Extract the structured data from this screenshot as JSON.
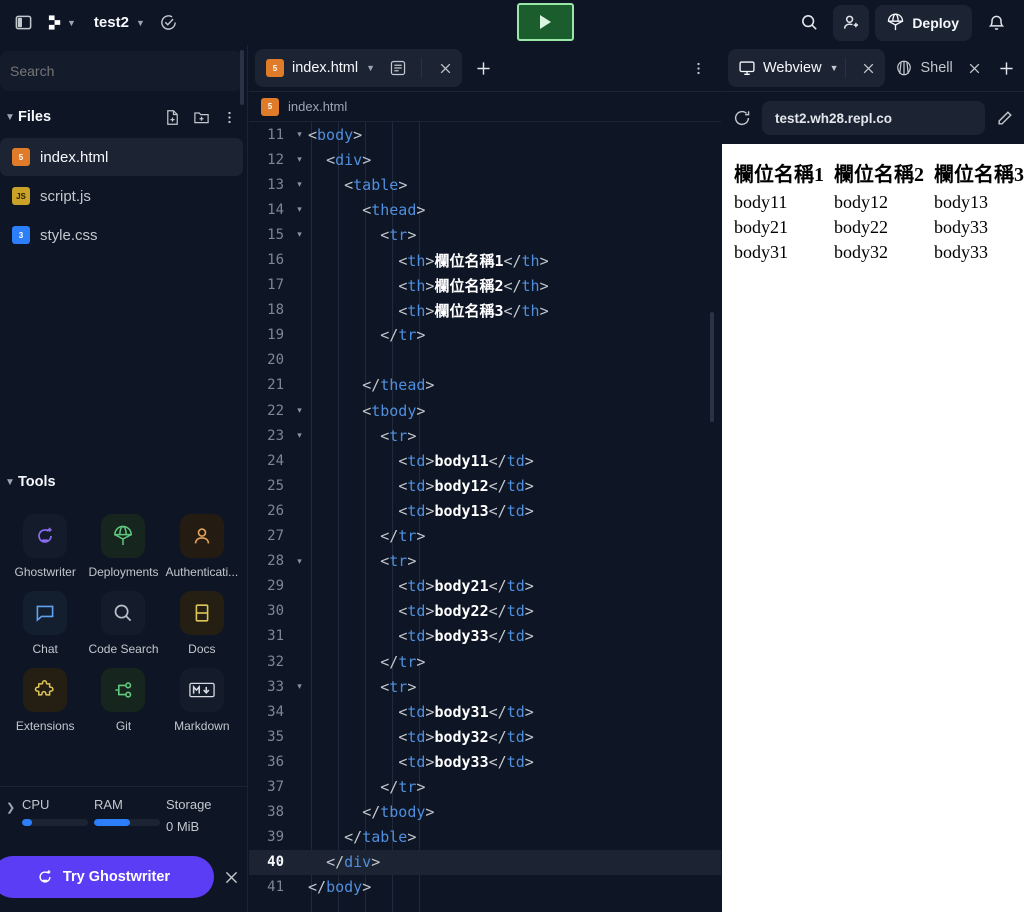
{
  "topbar": {
    "sidebar_toggle": "sidebar-toggle",
    "app_menu": "replit-logo",
    "project_name": "test2",
    "history_icon": "history-check-icon",
    "run_label": "run",
    "search_icon": "search-icon",
    "invite_icon": "invite-user-icon",
    "deploy_label": "Deploy",
    "notifications_icon": "bell-icon"
  },
  "sidebar": {
    "search": {
      "placeholder": "Search",
      "value": ""
    },
    "files_section": {
      "title": "Files",
      "new_file_icon": "new-file-icon",
      "new_folder_icon": "new-folder-icon",
      "more_icon": "kebab-menu-icon",
      "items": [
        {
          "name": "index.html",
          "kind": "html",
          "badge": "5",
          "active": true
        },
        {
          "name": "script.js",
          "kind": "js",
          "badge": "JS",
          "active": false
        },
        {
          "name": "style.css",
          "kind": "css",
          "badge": "3",
          "active": false
        }
      ]
    },
    "tools_section": {
      "title": "Tools",
      "items": [
        {
          "label": "Ghostwriter",
          "icon": "ghostwriter-icon"
        },
        {
          "label": "Deployments",
          "icon": "parachute-icon"
        },
        {
          "label": "Authenticati...",
          "icon": "person-icon"
        },
        {
          "label": "Chat",
          "icon": "chat-bubble-icon"
        },
        {
          "label": "Code Search",
          "icon": "magnifier-icon"
        },
        {
          "label": "Docs",
          "icon": "book-icon"
        },
        {
          "label": "Extensions",
          "icon": "puzzle-piece-icon"
        },
        {
          "label": "Git",
          "icon": "git-branch-icon"
        },
        {
          "label": "Markdown",
          "icon": "markdown-icon"
        }
      ]
    },
    "stats": {
      "expand_icon": "chevron-right-icon",
      "cpu": {
        "label": "CPU",
        "percent": 15
      },
      "ram": {
        "label": "RAM",
        "percent": 55
      },
      "storage": {
        "label": "Storage",
        "value": "0 MiB"
      }
    },
    "promo": {
      "label": "Try Ghostwriter",
      "icon": "ghostwriter-icon",
      "close_icon": "close-icon"
    }
  },
  "editor": {
    "tab": {
      "filename": "index.html",
      "file_icon": "html5-icon",
      "chevron_icon": "chevron-down-icon",
      "preview_icon": "document-view-icon",
      "close_icon": "close-icon"
    },
    "new_tab_icon": "plus-icon",
    "pane_menu_icon": "kebab-menu-icon",
    "breadcrumb": "index.html",
    "active_line": 40,
    "lines": [
      {
        "n": 11,
        "fold": true,
        "indent": 0,
        "html": "<span class=\"br\">&lt;</span><span class=\"tg\">body</span><span class=\"br\">&gt;</span>"
      },
      {
        "n": 12,
        "fold": true,
        "indent": 1,
        "html": "<span class=\"br\">&lt;</span><span class=\"tg\">div</span><span class=\"br\">&gt;</span>"
      },
      {
        "n": 13,
        "fold": true,
        "indent": 2,
        "html": "<span class=\"br\">&lt;</span><span class=\"tg\">table</span><span class=\"br\">&gt;</span>"
      },
      {
        "n": 14,
        "fold": true,
        "indent": 3,
        "html": "<span class=\"br\">&lt;</span><span class=\"tg\">thead</span><span class=\"br\">&gt;</span>"
      },
      {
        "n": 15,
        "fold": true,
        "indent": 4,
        "html": "<span class=\"br\">&lt;</span><span class=\"tg\">tr</span><span class=\"br\">&gt;</span>"
      },
      {
        "n": 16,
        "fold": false,
        "indent": 5,
        "html": "<span class=\"br\">&lt;</span><span class=\"tg\">th</span><span class=\"br\">&gt;</span><span class=\"tx\">欄位名稱1</span><span class=\"br\">&lt;/</span><span class=\"tg\">th</span><span class=\"br\">&gt;</span>"
      },
      {
        "n": 17,
        "fold": false,
        "indent": 5,
        "html": "<span class=\"br\">&lt;</span><span class=\"tg\">th</span><span class=\"br\">&gt;</span><span class=\"tx\">欄位名稱2</span><span class=\"br\">&lt;/</span><span class=\"tg\">th</span><span class=\"br\">&gt;</span>"
      },
      {
        "n": 18,
        "fold": false,
        "indent": 5,
        "html": "<span class=\"br\">&lt;</span><span class=\"tg\">th</span><span class=\"br\">&gt;</span><span class=\"tx\">欄位名稱3</span><span class=\"br\">&lt;/</span><span class=\"tg\">th</span><span class=\"br\">&gt;</span>"
      },
      {
        "n": 19,
        "fold": false,
        "indent": 4,
        "html": "<span class=\"br\">&lt;/</span><span class=\"tg\">tr</span><span class=\"br\">&gt;</span>"
      },
      {
        "n": 20,
        "fold": false,
        "indent": 0,
        "html": ""
      },
      {
        "n": 21,
        "fold": false,
        "indent": 3,
        "html": "<span class=\"br\">&lt;/</span><span class=\"tg\">thead</span><span class=\"br\">&gt;</span>"
      },
      {
        "n": 22,
        "fold": true,
        "indent": 3,
        "html": "<span class=\"br\">&lt;</span><span class=\"tg\">tbody</span><span class=\"br\">&gt;</span>"
      },
      {
        "n": 23,
        "fold": true,
        "indent": 4,
        "html": "<span class=\"br\">&lt;</span><span class=\"tg\">tr</span><span class=\"br\">&gt;</span>"
      },
      {
        "n": 24,
        "fold": false,
        "indent": 5,
        "html": "<span class=\"br\">&lt;</span><span class=\"tg\">td</span><span class=\"br\">&gt;</span><span class=\"tx\">body11</span><span class=\"br\">&lt;/</span><span class=\"tg\">td</span><span class=\"br\">&gt;</span>"
      },
      {
        "n": 25,
        "fold": false,
        "indent": 5,
        "html": "<span class=\"br\">&lt;</span><span class=\"tg\">td</span><span class=\"br\">&gt;</span><span class=\"tx\">body12</span><span class=\"br\">&lt;/</span><span class=\"tg\">td</span><span class=\"br\">&gt;</span>"
      },
      {
        "n": 26,
        "fold": false,
        "indent": 5,
        "html": "<span class=\"br\">&lt;</span><span class=\"tg\">td</span><span class=\"br\">&gt;</span><span class=\"tx\">body13</span><span class=\"br\">&lt;/</span><span class=\"tg\">td</span><span class=\"br\">&gt;</span>"
      },
      {
        "n": 27,
        "fold": false,
        "indent": 4,
        "html": "<span class=\"br\">&lt;/</span><span class=\"tg\">tr</span><span class=\"br\">&gt;</span>"
      },
      {
        "n": 28,
        "fold": true,
        "indent": 4,
        "html": "<span class=\"br\">&lt;</span><span class=\"tg\">tr</span><span class=\"br\">&gt;</span>"
      },
      {
        "n": 29,
        "fold": false,
        "indent": 5,
        "html": "<span class=\"br\">&lt;</span><span class=\"tg\">td</span><span class=\"br\">&gt;</span><span class=\"tx\">body21</span><span class=\"br\">&lt;/</span><span class=\"tg\">td</span><span class=\"br\">&gt;</span>"
      },
      {
        "n": 30,
        "fold": false,
        "indent": 5,
        "html": "<span class=\"br\">&lt;</span><span class=\"tg\">td</span><span class=\"br\">&gt;</span><span class=\"tx\">body22</span><span class=\"br\">&lt;/</span><span class=\"tg\">td</span><span class=\"br\">&gt;</span>"
      },
      {
        "n": 31,
        "fold": false,
        "indent": 5,
        "html": "<span class=\"br\">&lt;</span><span class=\"tg\">td</span><span class=\"br\">&gt;</span><span class=\"tx\">body33</span><span class=\"br\">&lt;/</span><span class=\"tg\">td</span><span class=\"br\">&gt;</span>"
      },
      {
        "n": 32,
        "fold": false,
        "indent": 4,
        "html": "<span class=\"br\">&lt;/</span><span class=\"tg\">tr</span><span class=\"br\">&gt;</span>"
      },
      {
        "n": 33,
        "fold": true,
        "indent": 4,
        "html": "<span class=\"br\">&lt;</span><span class=\"tg\">tr</span><span class=\"br\">&gt;</span>"
      },
      {
        "n": 34,
        "fold": false,
        "indent": 5,
        "html": "<span class=\"br\">&lt;</span><span class=\"tg\">td</span><span class=\"br\">&gt;</span><span class=\"tx\">body31</span><span class=\"br\">&lt;/</span><span class=\"tg\">td</span><span class=\"br\">&gt;</span>"
      },
      {
        "n": 35,
        "fold": false,
        "indent": 5,
        "html": "<span class=\"br\">&lt;</span><span class=\"tg\">td</span><span class=\"br\">&gt;</span><span class=\"tx\">body32</span><span class=\"br\">&lt;/</span><span class=\"tg\">td</span><span class=\"br\">&gt;</span>"
      },
      {
        "n": 36,
        "fold": false,
        "indent": 5,
        "html": "<span class=\"br\">&lt;</span><span class=\"tg\">td</span><span class=\"br\">&gt;</span><span class=\"tx\">body33</span><span class=\"br\">&lt;/</span><span class=\"tg\">td</span><span class=\"br\">&gt;</span>"
      },
      {
        "n": 37,
        "fold": false,
        "indent": 4,
        "html": "<span class=\"br\">&lt;/</span><span class=\"tg\">tr</span><span class=\"br\">&gt;</span>"
      },
      {
        "n": 38,
        "fold": false,
        "indent": 3,
        "html": "<span class=\"br\">&lt;/</span><span class=\"tg\">tbody</span><span class=\"br\">&gt;</span>"
      },
      {
        "n": 39,
        "fold": false,
        "indent": 2,
        "html": "<span class=\"br\">&lt;/</span><span class=\"tg\">table</span><span class=\"br\">&gt;</span>"
      },
      {
        "n": 40,
        "fold": false,
        "indent": 1,
        "html": "<span class=\"br\">&lt;/</span><span class=\"tg\">div</span><span class=\"br\">&gt;</span>"
      },
      {
        "n": 41,
        "fold": false,
        "indent": 0,
        "html": "<span class=\"br\">&lt;/</span><span class=\"tg\">body</span><span class=\"br\">&gt;</span>"
      }
    ]
  },
  "webview": {
    "tabs": [
      {
        "label": "Webview",
        "icon": "monitor-icon",
        "active": true,
        "has_chevron": true,
        "closable": true
      },
      {
        "label": "Shell",
        "icon": "shell-icon",
        "active": false,
        "has_chevron": false,
        "closable": true
      }
    ],
    "new_tab_icon": "plus-icon",
    "reload_icon": "reload-icon",
    "url": "test2.wh28.repl.co",
    "edit_icon": "pencil-icon",
    "page": {
      "headers": [
        "欄位名稱1",
        "欄位名稱2",
        "欄位名稱3"
      ],
      "rows": [
        [
          "body11",
          "body12",
          "body13"
        ],
        [
          "body21",
          "body22",
          "body33"
        ],
        [
          "body31",
          "body32",
          "body33"
        ]
      ]
    }
  },
  "colors": {
    "bg": "#0e1525",
    "panel": "#1c2333",
    "accent_blue": "#2d7ff9",
    "accent_purple": "#5b3df5",
    "run_green": "#1c5d2e",
    "run_border": "#9ae6a8",
    "tag_blue": "#4f8fdd"
  }
}
